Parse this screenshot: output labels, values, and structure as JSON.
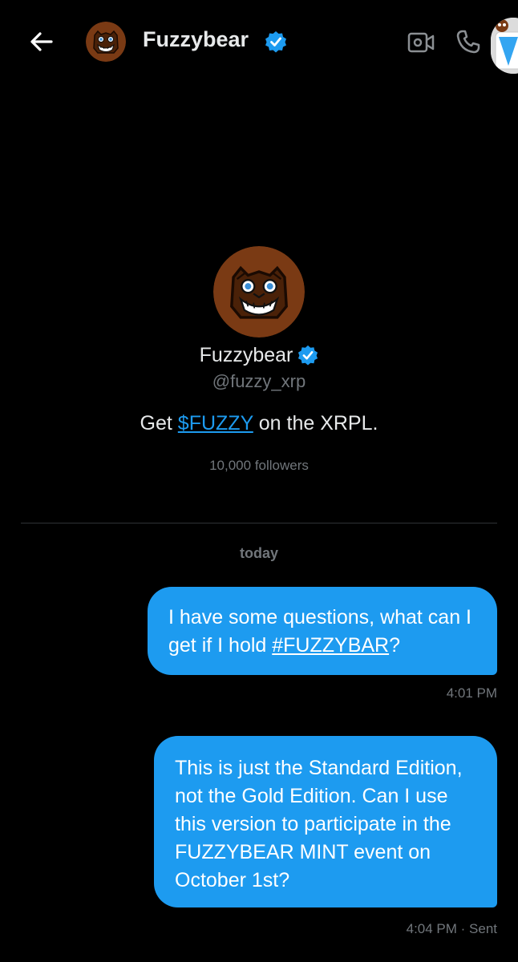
{
  "header": {
    "name": "Fuzzybear",
    "icons": [
      "back-arrow-icon",
      "verified-badge-icon",
      "video-call-icon",
      "phone-icon"
    ]
  },
  "profile": {
    "name": "Fuzzybear",
    "handle": "@fuzzy_xrp",
    "bio_prefix": "Get ",
    "bio_link": "$FUZZY",
    "bio_suffix": " on the XRPL.",
    "followers": "10,000 followers"
  },
  "conversation": {
    "date_label": "today",
    "messages": [
      {
        "text_prefix": "I have some questions, what can I get if I hold ",
        "hashtag": "#FUZZYBAR",
        "text_suffix": "?",
        "timestamp": "4:01 PM"
      },
      {
        "text": "This is just the Standard Edition, not the Gold Edition. Can I use this version to participate in the FUZZYBEAR MINT event on October 1st?",
        "timestamp": "4:04 PM · Sent"
      }
    ]
  },
  "colors": {
    "background": "#000000",
    "accent": "#1d9bf0",
    "bubble": "#1d9bf0",
    "muted": "#71767b",
    "avatar_brown": "#7a3a14"
  }
}
